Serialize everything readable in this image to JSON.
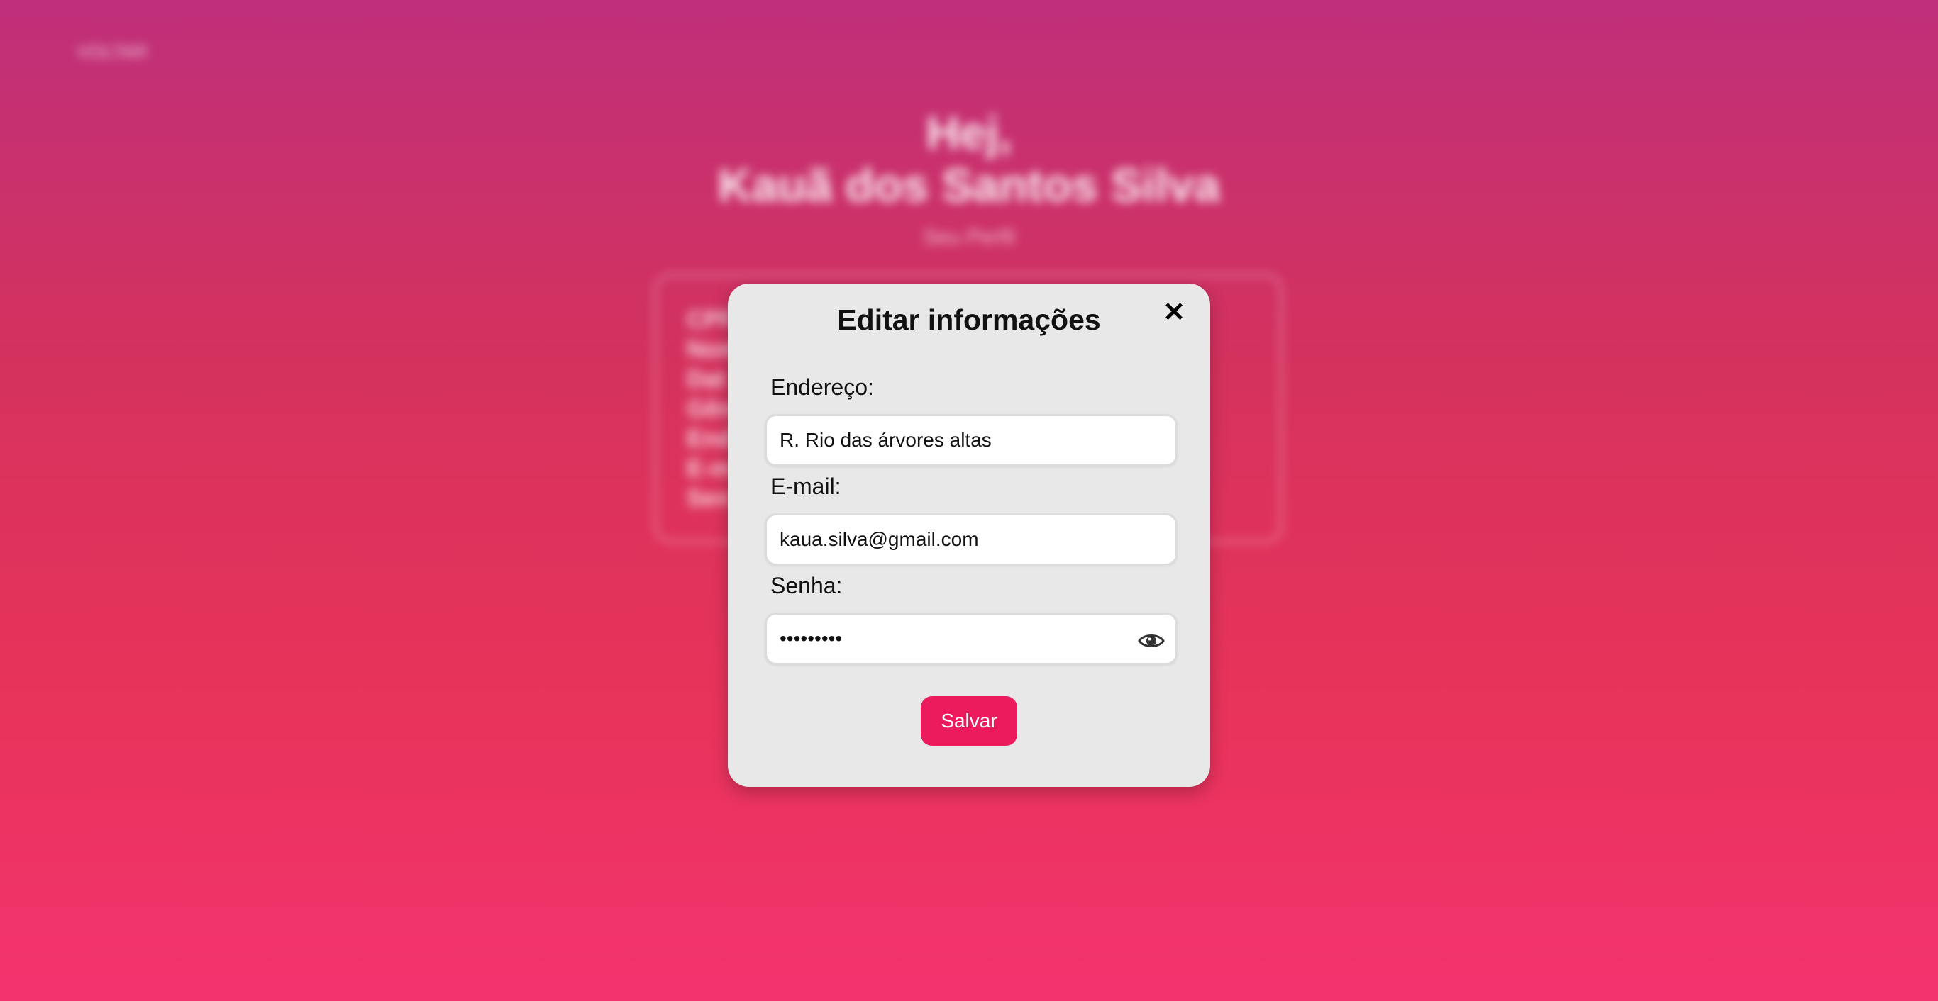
{
  "background": {
    "back_link": "VOLTAR",
    "greeting_line1": "Hej,",
    "greeting_line2": "Kauã dos Santos Silva",
    "subtitle": "Seu Perfil",
    "info_lines": [
      "CPF",
      "Nom",
      "Dat",
      "Gên",
      "End",
      "E-m",
      "Sen"
    ]
  },
  "modal": {
    "title": "Editar informações",
    "close_label": "✕",
    "address_label": "Endereço:",
    "address_value": "R. Rio das árvores altas",
    "email_label": "E-mail:",
    "email_value": "kaua.silva@gmail.com",
    "password_label": "Senha:",
    "password_value": "kauasilva",
    "password_toggle_icon": "eye-icon",
    "save_label": "Salvar"
  },
  "colors": {
    "accent": "#ec1b5e",
    "modal_bg": "#e8e8e8",
    "gradient_top": "#bf2f7a",
    "gradient_bottom": "#f3336e"
  }
}
